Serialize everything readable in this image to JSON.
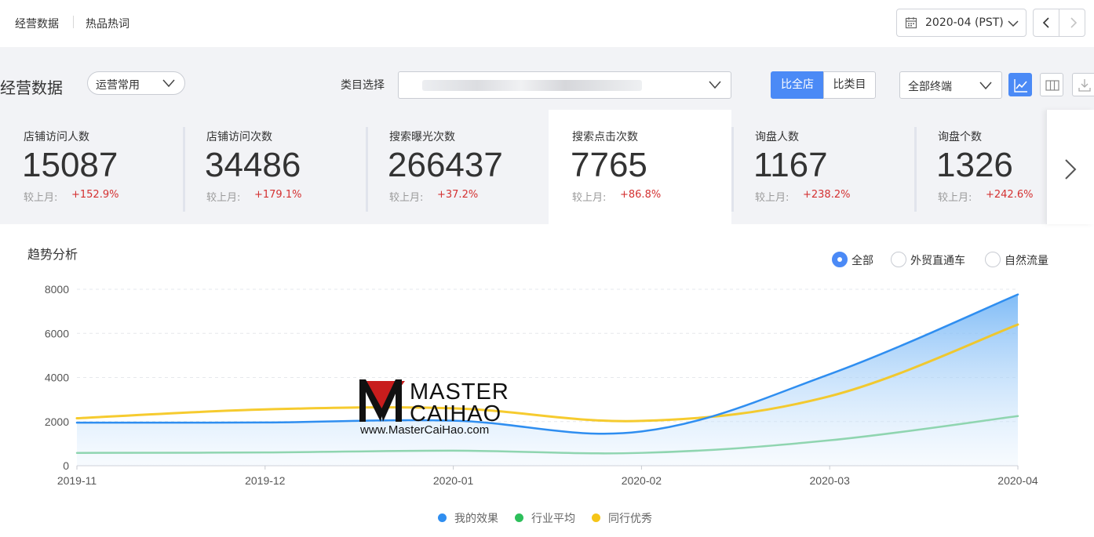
{
  "top_tabs": [
    "经营数据",
    "热品热词"
  ],
  "date_picker": {
    "value": "2020-04 (PST)"
  },
  "section_title": "经营数据",
  "preset_dropdown": "运营常用",
  "category": {
    "label": "类目选择",
    "value": ""
  },
  "compare": {
    "active": "比全店",
    "other": "比类目"
  },
  "terminal_dropdown": "全部终端",
  "metrics": [
    {
      "label": "店铺访问人数",
      "value": "15087",
      "compare_label": "较上月:",
      "change": "+152.9%"
    },
    {
      "label": "店铺访问次数",
      "value": "34486",
      "compare_label": "较上月:",
      "change": "+179.1%"
    },
    {
      "label": "搜索曝光次数",
      "value": "266437",
      "compare_label": "较上月:",
      "change": "+37.2%"
    },
    {
      "label": "搜索点击次数",
      "value": "7765",
      "compare_label": "较上月:",
      "change": "+86.8%"
    },
    {
      "label": "询盘人数",
      "value": "1167",
      "compare_label": "较上月:",
      "change": "+238.2%"
    },
    {
      "label": "询盘个数",
      "value": "1326",
      "compare_label": "较上月:",
      "change": "+242.6%"
    }
  ],
  "active_metric_index": 3,
  "trend": {
    "title": "趋势分析",
    "filters": [
      {
        "label": "全部",
        "selected": true
      },
      {
        "label": "外贸直通车",
        "selected": false
      },
      {
        "label": "自然流量",
        "selected": false
      }
    ]
  },
  "chart_data": {
    "type": "line",
    "x": [
      "2019-11",
      "2019-12",
      "2020-01",
      "2020-02",
      "2020-03",
      "2020-04"
    ],
    "y_ticks": [
      0,
      2000,
      4000,
      6000,
      8000
    ],
    "ylim": [
      0,
      8000
    ],
    "grid": true,
    "legend_position": "bottom",
    "series": [
      {
        "name": "我的效果",
        "values": [
          1950,
          1960,
          2040,
          1550,
          4150,
          7765
        ],
        "color": "#2f8ef0",
        "area": true
      },
      {
        "name": "行业平均",
        "values": [
          580,
          600,
          680,
          580,
          1150,
          2250
        ],
        "color": "#8fd5b0"
      },
      {
        "name": "同行优秀",
        "values": [
          2150,
          2550,
          2600,
          2030,
          3150,
          6400
        ],
        "color": "#f5c518"
      }
    ],
    "legend_colors": [
      "#2f8ef0",
      "#2dbf5b",
      "#f5c518"
    ]
  },
  "watermark": {
    "line1": "MASTER",
    "line2": "CAIHAO",
    "line3": "www.MasterCaiHao.com"
  },
  "colors": {
    "accent": "#4b8af6",
    "positive_change": "#d43131",
    "band": "#f2f3f6"
  }
}
